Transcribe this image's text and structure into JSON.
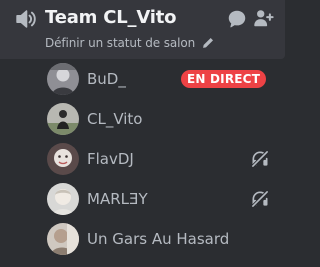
{
  "channel": {
    "name": "Team CL_Vito",
    "status_placeholder": "Définir un statut de salon",
    "icons": {
      "type": "speaker-icon",
      "chat": "chat-bubble-icon",
      "invite": "add-user-icon",
      "edit_status": "pencil-icon"
    }
  },
  "users": [
    {
      "name": "BuD_",
      "badge": "EN DIRECT",
      "deafened": false
    },
    {
      "name": "CL_Vito",
      "badge": "",
      "deafened": false
    },
    {
      "name": "FlavDJ",
      "badge": "",
      "deafened": true
    },
    {
      "name": "MARLƎY",
      "badge": "",
      "deafened": true
    },
    {
      "name": "Un Gars Au Hasard",
      "badge": "",
      "deafened": false
    }
  ],
  "colors": {
    "background": "#2b2d31",
    "header_background": "#36373d",
    "live_badge": "#ed4245",
    "text_primary": "#f2f3f5",
    "text_muted": "#b5bac1",
    "icon": "#b5bac1"
  }
}
